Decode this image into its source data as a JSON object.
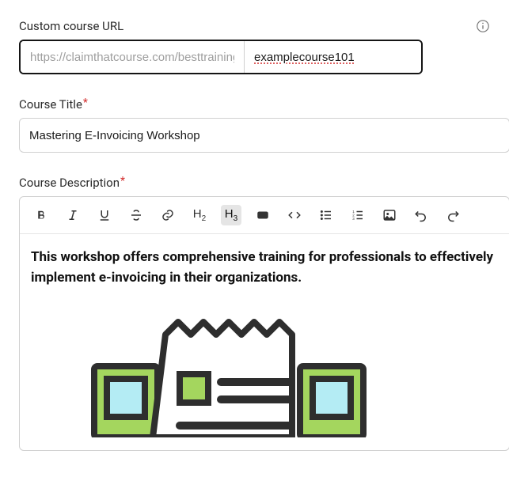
{
  "url_field": {
    "label": "Custom course URL",
    "prefix": "https://claimthatcourse.com/besttrainingco/c/",
    "slug": "examplecourse101"
  },
  "title_field": {
    "label": "Course Title",
    "value": "Mastering E-Invoicing Workshop"
  },
  "desc_field": {
    "label": "Course Description",
    "content": "This workshop offers comprehensive training for professionals to effectively implement e-invoicing in their organizations."
  },
  "toolbar": {
    "h2": "H",
    "h2sub": "2",
    "h3": "H",
    "h3sub": "3"
  }
}
